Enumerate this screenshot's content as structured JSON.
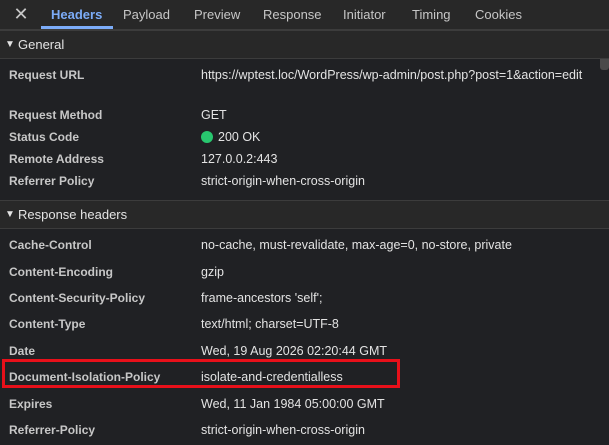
{
  "tabs": [
    {
      "label": "Headers",
      "active": true
    },
    {
      "label": "Payload"
    },
    {
      "label": "Preview"
    },
    {
      "label": "Response"
    },
    {
      "label": "Initiator"
    },
    {
      "label": "Timing"
    },
    {
      "label": "Cookies"
    }
  ],
  "icons": {
    "close": "close-icon",
    "expand_general": "triangle-down-icon",
    "expand_response": "triangle-down-icon",
    "status": "green-status-dot"
  },
  "colors": {
    "accent": "#7cacf8",
    "status_ok": "#28c76f",
    "highlight": "#e8101a",
    "background": "#202124"
  },
  "general": {
    "title": "General",
    "rows": [
      {
        "name": "Request URL",
        "value": "https://wptest.loc/WordPress/wp-admin/post.php?post=1&action=edit"
      },
      {
        "name": "Request Method",
        "value": "GET"
      },
      {
        "name": "Status Code",
        "value": "200 OK"
      },
      {
        "name": "Remote Address",
        "value": "127.0.0.2:443"
      },
      {
        "name": "Referrer Policy",
        "value": "strict-origin-when-cross-origin"
      }
    ]
  },
  "response_headers": {
    "title": "Response headers",
    "rows": [
      {
        "name": "Cache-Control",
        "value": "no-cache, must-revalidate, max-age=0, no-store, private"
      },
      {
        "name": "Content-Encoding",
        "value": "gzip"
      },
      {
        "name": "Content-Security-Policy",
        "value": "frame-ancestors 'self';"
      },
      {
        "name": "Content-Type",
        "value": "text/html; charset=UTF-8"
      },
      {
        "name": "Date",
        "value": "Wed, 19 Aug 2026 02:20:44 GMT"
      },
      {
        "name": "Document-Isolation-Policy",
        "value": "isolate-and-credentialless"
      },
      {
        "name": "Expires",
        "value": "Wed, 11 Jan 1984 05:00:00 GMT"
      },
      {
        "name": "Referrer-Policy",
        "value": "strict-origin-when-cross-origin"
      }
    ]
  }
}
